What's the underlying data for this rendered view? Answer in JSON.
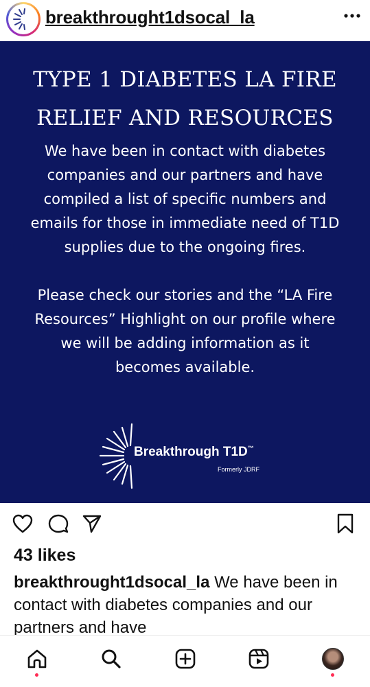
{
  "header": {
    "username": "breakthrought1dsocal_la",
    "more_icon": "more-horizontal-icon"
  },
  "post": {
    "background": "#0d1760",
    "title_line1": "TYPE 1 DIABETES LA FIRE",
    "title_line2": "RELIEF AND RESOURCES",
    "paragraph1": "We have been in contact with diabetes companies and our partners and have compiled a list of specific numbers and emails for those in immediate need of T1D supplies due to the ongoing fires.",
    "paragraph2": "Please check our stories and the “LA Fire Resources” Highlight on our profile where we will be adding information as it becomes available.",
    "logo_name": "Breakthrough T1D",
    "logo_tm": "™",
    "logo_sub": "Formerly JDRF"
  },
  "actions": {
    "like_icon": "heart-icon",
    "comment_icon": "comment-icon",
    "share_icon": "send-icon",
    "save_icon": "bookmark-icon"
  },
  "likes": "43 likes",
  "caption": {
    "username": "breakthrought1dsocal_la",
    "text": " We have been in contact with diabetes companies and our partners and have"
  },
  "tabbar": {
    "items": [
      "home-icon",
      "search-icon",
      "create-icon",
      "reels-icon",
      "profile-avatar"
    ]
  }
}
